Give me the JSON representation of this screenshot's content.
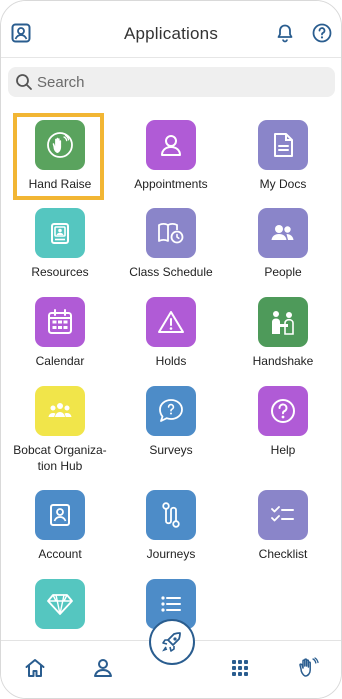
{
  "header": {
    "title": "Applications",
    "left_icon": "profile-card-icon",
    "bell_icon": "bell-icon",
    "help_icon": "help-icon"
  },
  "search": {
    "placeholder": "Search"
  },
  "apps": [
    {
      "label": "Hand Raise",
      "color": "#5aa35e",
      "icon": "hand-raise-icon",
      "highlighted": true
    },
    {
      "label": "Appointments",
      "color": "#b05bd6",
      "icon": "person-icon"
    },
    {
      "label": "My Docs",
      "color": "#8a85c9",
      "icon": "document-icon"
    },
    {
      "label": "Resources",
      "color": "#55c6c0",
      "icon": "resources-icon"
    },
    {
      "label": "Class Schedule",
      "color": "#8a85c9",
      "icon": "book-clock-icon"
    },
    {
      "label": "People",
      "color": "#8a85c9",
      "icon": "people-icon"
    },
    {
      "label": "Calendar",
      "color": "#b05bd6",
      "icon": "calendar-icon"
    },
    {
      "label": "Holds",
      "color": "#b05bd6",
      "icon": "warning-icon"
    },
    {
      "label": "Handshake",
      "color": "#4e9a5a",
      "icon": "handshake-icon"
    },
    {
      "label": "Bobcat Organiza-\ntion Hub",
      "color": "#f1e54a",
      "icon": "group-icon"
    },
    {
      "label": "Surveys",
      "color": "#4d8cc8",
      "icon": "chat-question-icon"
    },
    {
      "label": "Help",
      "color": "#b05bd6",
      "icon": "question-icon"
    },
    {
      "label": "Account",
      "color": "#4d8cc8",
      "icon": "account-icon"
    },
    {
      "label": "Journeys",
      "color": "#4d8cc8",
      "icon": "journey-icon"
    },
    {
      "label": "Checklist",
      "color": "#8a85c9",
      "icon": "checklist-icon"
    },
    {
      "label": "",
      "color": "#55c6c0",
      "icon": "diamond-icon"
    },
    {
      "label": "",
      "color": "#4d8cc8",
      "icon": "list-icon"
    }
  ],
  "bottom_nav": {
    "items": [
      "home-icon",
      "profile-icon",
      "rocket-icon",
      "apps-grid-icon",
      "hand-raise-nav-icon"
    ],
    "accent": "#2a5d8f"
  },
  "highlight_color": "#f2b634"
}
